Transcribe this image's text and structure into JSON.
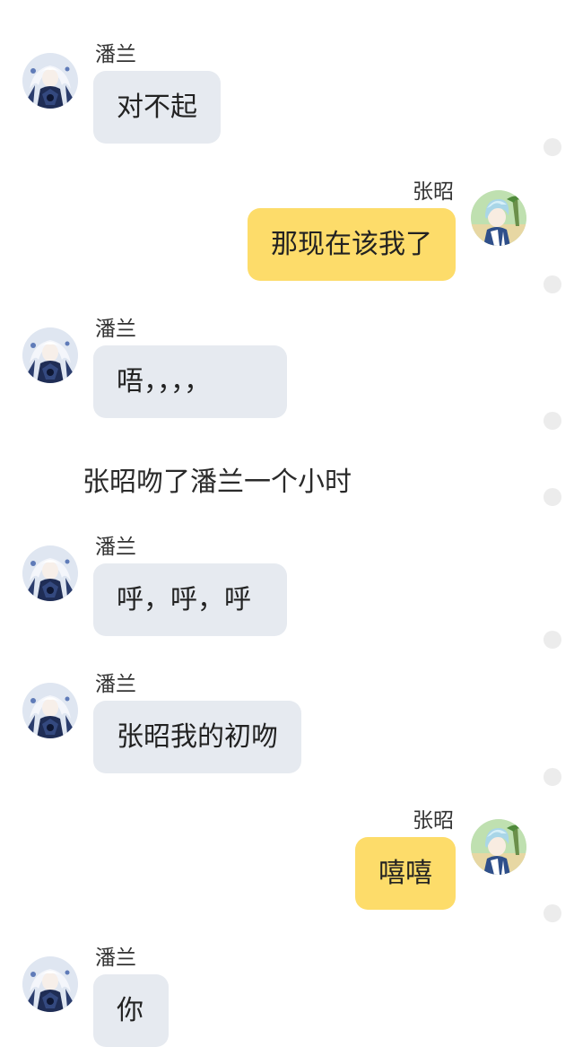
{
  "messages": [
    {
      "side": "left",
      "sender": "潘兰",
      "text": "对不起"
    },
    {
      "side": "right",
      "sender": "张昭",
      "text": "那现在该我了"
    },
    {
      "side": "left",
      "sender": "潘兰",
      "text": "唔，，，，"
    },
    {
      "side": "narration",
      "text": "张昭吻了潘兰一个小时"
    },
    {
      "side": "left",
      "sender": "潘兰",
      "text": "呼，呼，呼"
    },
    {
      "side": "left",
      "sender": "潘兰",
      "text": "张昭我的初吻"
    },
    {
      "side": "right",
      "sender": "张昭",
      "text": "嘻嘻"
    },
    {
      "side": "left",
      "sender": "潘兰",
      "text": "你"
    }
  ],
  "colors": {
    "left_bubble": "#e6eaf0",
    "right_bubble": "#fddc6a",
    "background": "#ffffff",
    "status_dot": "#ececec"
  },
  "icons": {
    "left_avatar": "anime-girl-avatar",
    "right_avatar": "anime-boy-avatar",
    "status_dot": "read-status-dot"
  }
}
